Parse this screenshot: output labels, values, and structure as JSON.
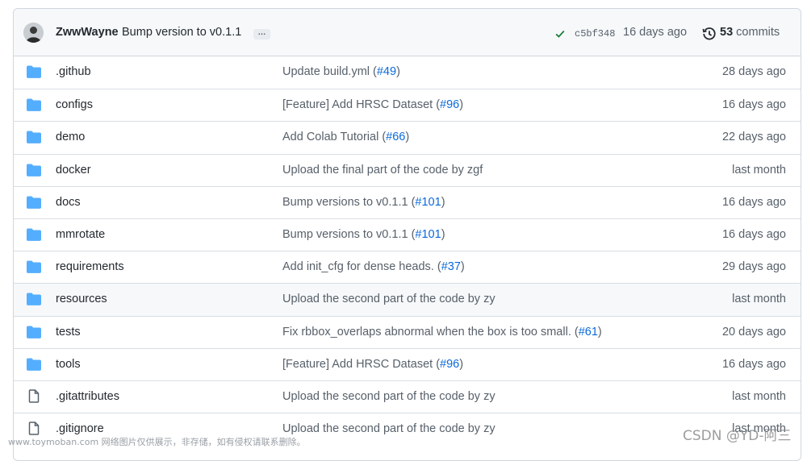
{
  "commit": {
    "author": "ZwwWayne",
    "message": "Bump version to v0.1.1",
    "ellipsis": "…",
    "sha": "c5bf348",
    "time": "16 days ago",
    "count": "53",
    "count_label": "commits"
  },
  "files": [
    {
      "type": "folder",
      "name": ".github",
      "msg": "Update build.yml (",
      "link": "#49",
      "tail": ")",
      "age": "28 days ago"
    },
    {
      "type": "folder",
      "name": "configs",
      "msg": "[Feature] Add HRSC Dataset (",
      "link": "#96",
      "tail": ")",
      "age": "16 days ago"
    },
    {
      "type": "folder",
      "name": "demo",
      "msg": "Add Colab Tutorial (",
      "link": "#66",
      "tail": ")",
      "age": "22 days ago"
    },
    {
      "type": "folder",
      "name": "docker",
      "msg": "Upload the final part of the code by zgf",
      "link": "",
      "tail": "",
      "age": "last month"
    },
    {
      "type": "folder",
      "name": "docs",
      "msg": "Bump versions to v0.1.1 (",
      "link": "#101",
      "tail": ")",
      "age": "16 days ago"
    },
    {
      "type": "folder",
      "name": "mmrotate",
      "msg": "Bump versions to v0.1.1 (",
      "link": "#101",
      "tail": ")",
      "age": "16 days ago"
    },
    {
      "type": "folder",
      "name": "requirements",
      "msg": "Add init_cfg for dense heads. (",
      "link": "#37",
      "tail": ")",
      "age": "29 days ago"
    },
    {
      "type": "folder",
      "name": "resources",
      "msg": "Upload the second part of the code by zy",
      "link": "",
      "tail": "",
      "age": "last month"
    },
    {
      "type": "folder",
      "name": "tests",
      "msg": "Fix rbbox_overlaps abnormal when the box is too small. (",
      "link": "#61",
      "tail": ")",
      "age": "20 days ago"
    },
    {
      "type": "folder",
      "name": "tools",
      "msg": "[Feature] Add HRSC Dataset (",
      "link": "#96",
      "tail": ")",
      "age": "16 days ago"
    },
    {
      "type": "file",
      "name": ".gitattributes",
      "msg": "Upload the second part of the code by zy",
      "link": "",
      "tail": "",
      "age": "last month"
    },
    {
      "type": "file",
      "name": ".gitignore",
      "msg": "Upload the second part of the code by zy",
      "link": "",
      "tail": "",
      "age": "last month"
    }
  ],
  "watermark_left": "www.toymoban.com 网络图片仅供展示，非存储，如有侵权请联系删除。",
  "watermark_right": "CSDN @YD-阿三",
  "colors": {
    "folder": "#54aeff",
    "file": "#57606a",
    "link": "#0969da",
    "check": "#1a7f37"
  }
}
